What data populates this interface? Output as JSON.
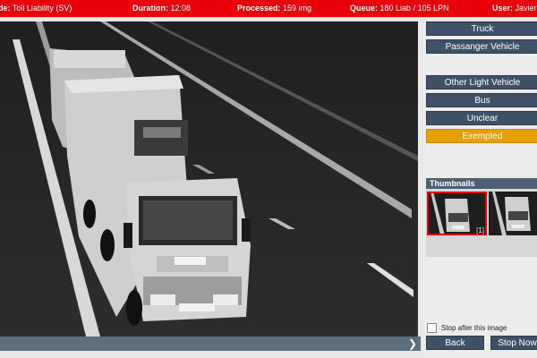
{
  "topbar": {
    "mode_label": "de:",
    "mode_value": "Toll Liability (SV)",
    "duration_label": "Duration:",
    "duration_value": "12:08",
    "processed_label": "Processed:",
    "processed_value": "159 img",
    "queue_label": "Queue:",
    "queue_value": "180 Liab / 105 LPN",
    "user_label": "User:",
    "user_value": "Javier N"
  },
  "categories": [
    {
      "label": "Truck"
    },
    {
      "label": "Passanger Vehicle"
    },
    {
      "label": "Other Light Vehicle"
    },
    {
      "label": "Bus"
    },
    {
      "label": "Unclear"
    },
    {
      "label": "Exempted"
    }
  ],
  "thumbnails": {
    "header": "Thumbnails",
    "items": [
      {
        "label": "[1]",
        "selected": true
      },
      {
        "label": "",
        "selected": false
      }
    ]
  },
  "stop_after": {
    "label": "Stop after this image",
    "checked": false
  },
  "footer": {
    "back_label": "Back",
    "stop_label": "Stop Now"
  },
  "viewport": {
    "next_icon": "chevron-right-icon"
  },
  "colors": {
    "topbar": "#e8000b",
    "button": "#3e5166",
    "exempted": "#e7a000"
  }
}
